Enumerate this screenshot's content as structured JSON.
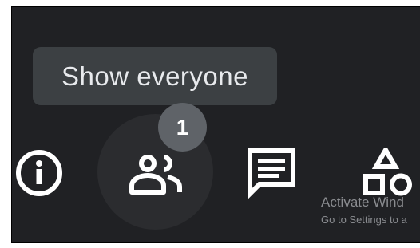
{
  "tooltip": {
    "text": "Show everyone"
  },
  "people": {
    "badge_count": "1"
  },
  "controls": {
    "info_icon": "info-icon",
    "people_icon": "people-icon",
    "chat_icon": "chat-icon",
    "activities_icon": "activities-icon"
  },
  "watermark": {
    "title": "Activate Wind",
    "subtitle": "Go to Settings to a"
  },
  "colors": {
    "background": "#202124",
    "tooltip_bg": "#3c4043",
    "badge_bg": "#5f6368",
    "icon": "#ffffff"
  }
}
